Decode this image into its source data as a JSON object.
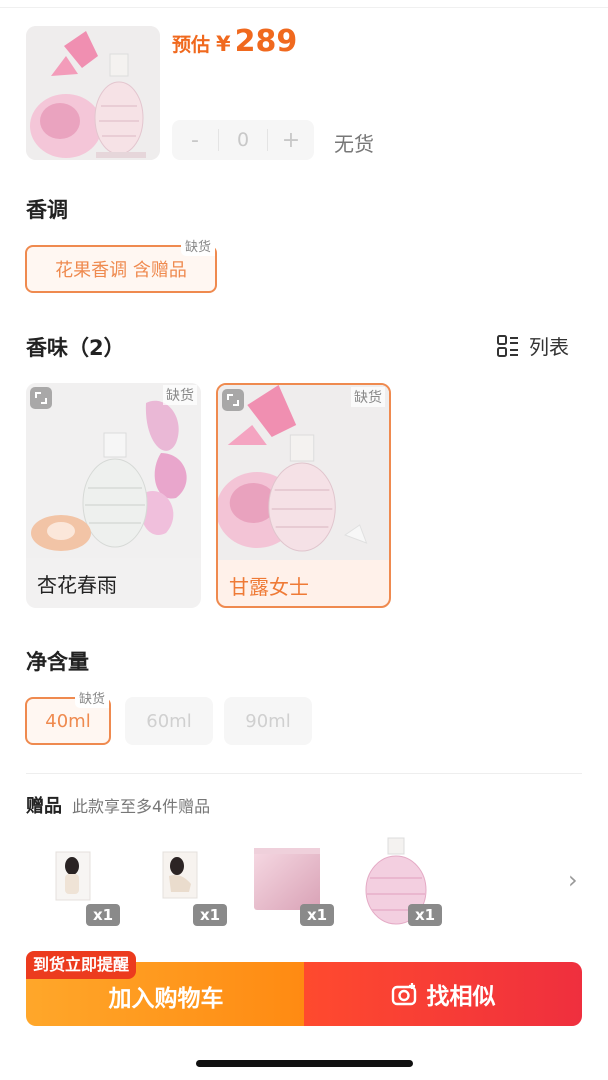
{
  "product": {
    "price_prefix": "预估",
    "currency": "¥",
    "price": "289",
    "quantity": "0",
    "minus": "-",
    "plus": "+",
    "stock_status": "无货"
  },
  "sections": {
    "note_title": "香调",
    "scent_title": "香味（2）",
    "volume_title": "净含量",
    "list_toggle_label": "列表"
  },
  "note_options": [
    {
      "label": "花果香调 含赠品",
      "tag": "缺货",
      "state": "selected"
    }
  ],
  "scent_options": [
    {
      "name": "杏花春雨",
      "tag": "缺货",
      "state": "normal"
    },
    {
      "name": "甘露女士",
      "tag": "缺货",
      "state": "selected"
    }
  ],
  "volume_options": [
    {
      "label": "40ml",
      "tag": "缺货",
      "state": "selected"
    },
    {
      "label": "60ml",
      "state": "disabled"
    },
    {
      "label": "90ml",
      "state": "disabled"
    }
  ],
  "gifts": {
    "title": "赠品",
    "description": "此款享至多4件赠品",
    "items": [
      {
        "icon": "photo-card-1",
        "qty": "x1"
      },
      {
        "icon": "photo-card-2",
        "qty": "x1"
      },
      {
        "icon": "gift-box",
        "qty": "x1"
      },
      {
        "icon": "perfume-bottle",
        "qty": "x1"
      }
    ]
  },
  "actions": {
    "notify_tag": "到货立即提醒",
    "add_to_cart": "加入购物车",
    "find_similar": "找相似"
  },
  "colors": {
    "accent_orange": "#ef8a4f",
    "price_orange": "#f0691e",
    "cart_orange": "#ff9a1f",
    "similar_red": "#f33a36"
  }
}
